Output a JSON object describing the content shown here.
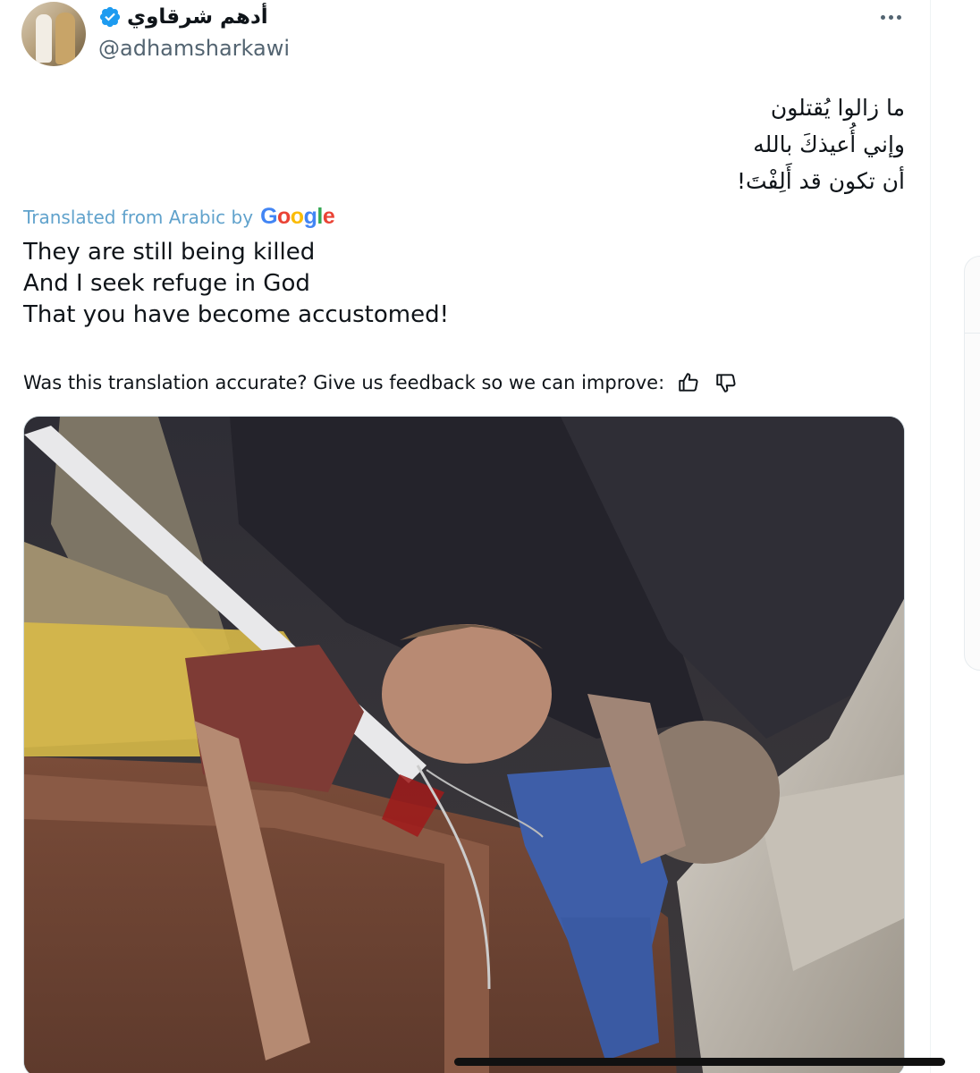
{
  "tweet": {
    "display_name": "أدهم شرقاوي",
    "handle": "@adhamsharkawi",
    "verified": true,
    "original_lines": [
      "ما زالوا يُقتلون",
      "وإني أُعيذكَ بالله",
      "أن تكون قد أَلِفْتَ!"
    ],
    "translated_prefix": "Translated from Arabic by",
    "translated_provider": "Google",
    "translated_lines": [
      "They are still being killed",
      "And I seek refuge in God",
      "That you have become accustomed!"
    ],
    "feedback_prompt": "Was this translation accurate? Give us feedback so we can improve:"
  },
  "icons": {
    "more": "more-dots-icon",
    "verified": "verified-badge-icon",
    "thumbs_up": "thumbs-up-icon",
    "thumbs_down": "thumbs-down-icon"
  },
  "colors": {
    "text_primary": "#0f1419",
    "text_secondary": "#536471",
    "verified_blue": "#1d9bf0",
    "translation_link": "#60a2cc"
  }
}
